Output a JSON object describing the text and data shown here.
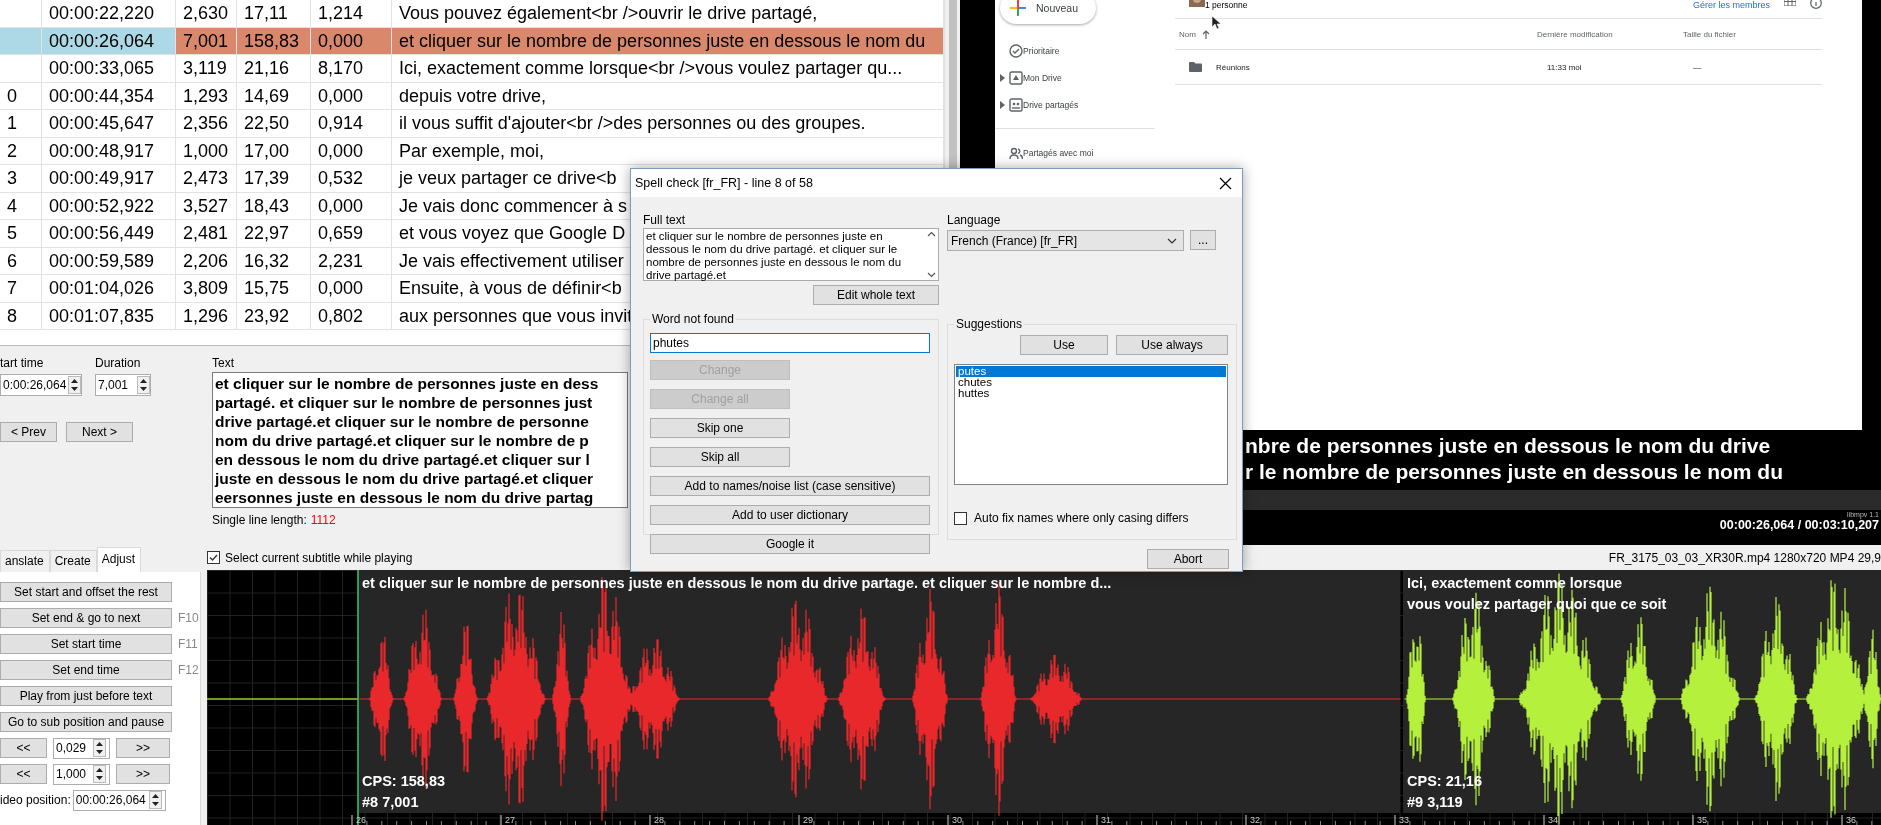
{
  "table": {
    "rows": [
      {
        "start": "00:00:22,220",
        "duration": "2,630",
        "cps": "17,11",
        "gap": "1,214",
        "text": "Vous pouvez également<br />ouvrir le drive partagé,",
        "selected": false,
        "error": false
      },
      {
        "start": "00:00:26,064",
        "duration": "7,001",
        "cps": "158,83",
        "gap": "0,000",
        "text": "et cliquer sur le nombre de personnes juste en dessous le nom du",
        "selected": true,
        "error": true
      },
      {
        "start": "00:00:33,065",
        "duration": "3,119",
        "cps": "21,16",
        "gap": "8,170",
        "text": "Ici, exactement comme lorsque<br />vous voulez partager qu...",
        "selected": false,
        "error": false
      },
      {
        "number": "0",
        "start": "00:00:44,354",
        "duration": "1,293",
        "cps": "14,69",
        "gap": "0,000",
        "text": "depuis votre drive,",
        "selected": false,
        "error": false
      },
      {
        "number": "1",
        "start": "00:00:45,647",
        "duration": "2,356",
        "cps": "22,50",
        "gap": "0,914",
        "text": "il vous suffit d'ajouter<br />des personnes ou des groupes.",
        "selected": false,
        "error": false
      },
      {
        "number": "2",
        "start": "00:00:48,917",
        "duration": "1,000",
        "cps": "17,00",
        "gap": "0,000",
        "text": "Par exemple, moi,",
        "selected": false,
        "error": false
      },
      {
        "number": "3",
        "start": "00:00:49,917",
        "duration": "2,473",
        "cps": "17,39",
        "gap": "0,532",
        "text": "je veux partager ce drive<b",
        "selected": false,
        "error": false
      },
      {
        "number": "4",
        "start": "00:00:52,922",
        "duration": "3,527",
        "cps": "18,43",
        "gap": "0,000",
        "text": "Je vais donc commencer à s",
        "selected": false,
        "error": false
      },
      {
        "number": "5",
        "start": "00:00:56,449",
        "duration": "2,481",
        "cps": "22,97",
        "gap": "0,659",
        "text": "et vous voyez que Google D",
        "selected": false,
        "error": false
      },
      {
        "number": "6",
        "start": "00:00:59,589",
        "duration": "2,206",
        "cps": "16,32",
        "gap": "2,231",
        "text": "Je vais effectivement utiliser",
        "selected": false,
        "error": false
      },
      {
        "number": "7",
        "start": "00:01:04,026",
        "duration": "3,809",
        "cps": "15,75",
        "gap": "0,000",
        "text": "Ensuite, à vous de définir<b",
        "selected": false,
        "error": false
      },
      {
        "number": "8",
        "start": "00:01:07,835",
        "duration": "1,296",
        "cps": "23,92",
        "gap": "0,802",
        "text": "aux personnes que vous invit",
        "selected": false,
        "error": false
      }
    ]
  },
  "editor": {
    "start_time": {
      "label": "tart time",
      "value": "0:00:26,064"
    },
    "duration": {
      "label": "Duration",
      "value": "7,001"
    },
    "nav_buttons": [
      "< Prev",
      "Next >"
    ],
    "text": {
      "label": "Text",
      "lines": [
        "et cliquer sur le nombre de personnes juste en dess",
        "partagé. et cliquer sur le nombre de personnes just",
        "drive partagé.et cliquer sur le nombre de personne",
        "nom du drive partagé.et cliquer sur le nombre de p",
        "en dessous le nom du drive partagé.et cliquer sur l",
        "juste en dessous le nom du drive partagé.et cliquer",
        "eersonnes juste en dessous le nom du drive partag"
      ]
    },
    "line_length": {
      "label": "Single line length:",
      "value": "1112"
    }
  },
  "video": {
    "drive": {
      "new_button": "Nouveau",
      "nav": [
        {
          "label": "Prioritaire",
          "expandable": false
        },
        {
          "label": "Mon Drive",
          "expandable": true
        },
        {
          "label": "Drive partagés",
          "expandable": true
        },
        {
          "label": "Partagés avec moi",
          "expandable": false
        }
      ],
      "members": "1 personne",
      "manage": "Gérer les membres",
      "columns": [
        "Nom",
        "Dernière modification",
        "Taille du fichier"
      ],
      "rows": [
        {
          "name": "Réunions",
          "modified": "11:33 moi",
          "size": "—"
        }
      ]
    },
    "subtitle_lines": [
      "nbre de personnes juste en dessous le nom du drive",
      "r le nombre de personnes juste en dessous le nom du"
    ],
    "player_label": "libmpv 1.1",
    "time": "00:00:26,064 / 00:03:10,207"
  },
  "adjust": {
    "tabs": [
      {
        "label": "anslate",
        "selected": false
      },
      {
        "label": "Create",
        "selected": false
      },
      {
        "label": "Adjust",
        "selected": true
      }
    ],
    "actions": [
      {
        "label": "Set start and offset the rest"
      },
      {
        "label": "Set end & go to next",
        "shortcut": "F10"
      },
      {
        "label": "Set start time",
        "shortcut": "F11"
      },
      {
        "label": "Set end time",
        "shortcut": "F12"
      },
      {
        "label": "Play from just before text"
      },
      {
        "label": "Go to sub position and pause"
      }
    ],
    "steppers": [
      {
        "back": "<<",
        "value": "0,029",
        "forward": ">>"
      },
      {
        "back": "<<",
        "value": "1,000",
        "forward": ">>"
      }
    ],
    "video_position": {
      "label": "ideo position:",
      "value": "00:00:26,064"
    }
  },
  "waveform": {
    "follow": {
      "label": "Select current subtitle while playing",
      "checked": true
    },
    "file_info": "FR_3175_03_03_XR30R.mp4 1280x720 MP4 29,9",
    "segments": [
      {
        "color": "#e8282b",
        "title_lines": [
          "et cliquer sur le nombre de personnes juste en dessous le nom du drive partage. et cliquer sur le nombre d..."
        ],
        "cps": "CPS: 158,83",
        "info": "#8  7,001"
      },
      {
        "color": "#b4f03c",
        "title_lines": [
          "Ici, exactement comme lorsque",
          "vous voulez partager quoi que ce soit"
        ],
        "cps": "CPS: 21,16",
        "info": "#9  3,119"
      }
    ],
    "ticks": [
      "26",
      "27",
      "28",
      "29",
      "30",
      "31",
      "32",
      "33",
      "34",
      "35",
      "36"
    ]
  },
  "dialog": {
    "title": "Spell check [fr_FR] - line 8 of 58",
    "full_text": {
      "label": "Full text",
      "value": "et cliquer sur le nombre de personnes juste en dessous le nom du drive partagé. et cliquer sur le nombre de personnes juste en dessous le nom du drive partagé.et"
    },
    "edit_button": "Edit whole text",
    "word_not_found": {
      "label": "Word not found",
      "value": "phutes"
    },
    "actions": [
      {
        "label": "Change",
        "disabled": true,
        "kind": "half"
      },
      {
        "label": "Change all",
        "disabled": true,
        "kind": "half"
      },
      {
        "label": "Skip one",
        "disabled": false,
        "kind": "half"
      },
      {
        "label": "Skip all",
        "disabled": false,
        "kind": "half"
      },
      {
        "label": "Add to names/noise list (case sensitive)",
        "disabled": false,
        "kind": "full"
      },
      {
        "label": "Add to user dictionary",
        "disabled": false,
        "kind": "full"
      },
      {
        "label": "Google it",
        "disabled": false,
        "kind": "full"
      }
    ],
    "language": {
      "label": "Language",
      "value": "French (France) [fr_FR]",
      "more": "..."
    },
    "suggestions": {
      "label": "Suggestions",
      "buttons": [
        "Use",
        "Use always"
      ],
      "items": [
        {
          "label": "putes",
          "selected": true
        },
        {
          "label": "chutes",
          "selected": false
        },
        {
          "label": "huttes",
          "selected": false
        }
      ]
    },
    "auto_fix": {
      "label": "Auto fix names where only casing differs",
      "checked": false
    },
    "abort": "Abort"
  }
}
